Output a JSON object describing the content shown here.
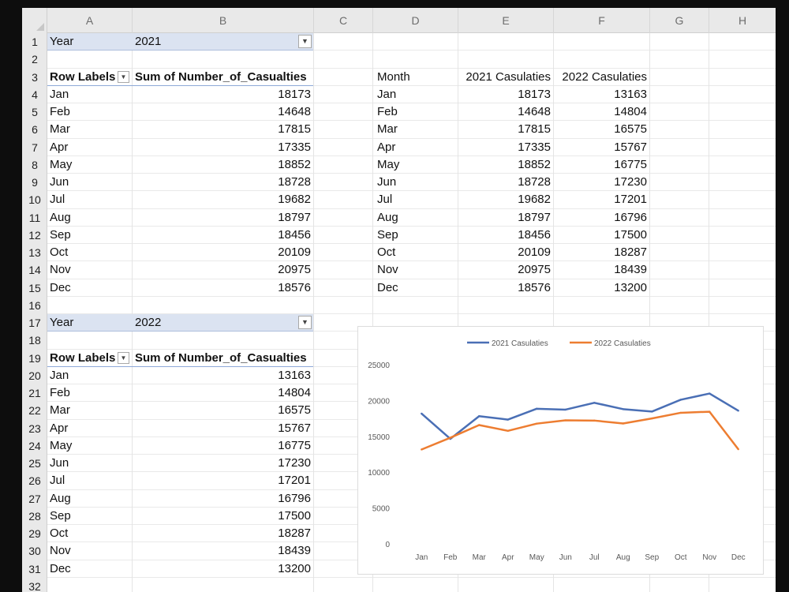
{
  "columns": [
    "A",
    "B",
    "C",
    "D",
    "E",
    "F",
    "G",
    "H"
  ],
  "rows": [
    "1",
    "2",
    "3",
    "4",
    "5",
    "6",
    "7",
    "8",
    "9",
    "10",
    "11",
    "12",
    "13",
    "14",
    "15",
    "16",
    "17",
    "18",
    "19",
    "20",
    "21",
    "22",
    "23",
    "24",
    "25",
    "26",
    "27",
    "28",
    "29",
    "30",
    "31",
    "32"
  ],
  "pivot2021": {
    "filter_label": "Year",
    "filter_value": "2021",
    "row_labels_header": "Row Labels",
    "value_header": "Sum of Number_of_Casualties",
    "months": [
      "Jan",
      "Feb",
      "Mar",
      "Apr",
      "May",
      "Jun",
      "Jul",
      "Aug",
      "Sep",
      "Oct",
      "Nov",
      "Dec"
    ],
    "values": [
      "18173",
      "14648",
      "17815",
      "17335",
      "18852",
      "18728",
      "19682",
      "18797",
      "18456",
      "20109",
      "20975",
      "18576"
    ]
  },
  "pivot2022": {
    "filter_label": "Year",
    "filter_value": "2022",
    "row_labels_header": "Row Labels",
    "value_header": "Sum of Number_of_Casualties",
    "months": [
      "Jan",
      "Feb",
      "Mar",
      "Apr",
      "May",
      "Jun",
      "Jul",
      "Aug",
      "Sep",
      "Oct",
      "Nov",
      "Dec"
    ],
    "values": [
      "13163",
      "14804",
      "16575",
      "15767",
      "16775",
      "17230",
      "17201",
      "16796",
      "17500",
      "18287",
      "18439",
      "13200"
    ]
  },
  "comparison": {
    "headers": [
      "Month",
      "2021 Casulaties",
      "2022 Casulaties"
    ],
    "rows": [
      [
        "Jan",
        "18173",
        "13163"
      ],
      [
        "Feb",
        "14648",
        "14804"
      ],
      [
        "Mar",
        "17815",
        "16575"
      ],
      [
        "Apr",
        "17335",
        "15767"
      ],
      [
        "May",
        "18852",
        "16775"
      ],
      [
        "Jun",
        "18728",
        "17230"
      ],
      [
        "Jul",
        "19682",
        "17201"
      ],
      [
        "Aug",
        "18797",
        "16796"
      ],
      [
        "Sep",
        "18456",
        "17500"
      ],
      [
        "Oct",
        "20109",
        "18287"
      ],
      [
        "Nov",
        "20975",
        "18439"
      ],
      [
        "Dec",
        "18576",
        "13200"
      ]
    ]
  },
  "chart_data": {
    "type": "line",
    "title": "",
    "xlabel": "",
    "ylabel": "",
    "x": [
      "Jan",
      "Feb",
      "Mar",
      "Apr",
      "May",
      "Jun",
      "Jul",
      "Aug",
      "Sep",
      "Oct",
      "Nov",
      "Dec"
    ],
    "yticks": [
      "0",
      "5000",
      "10000",
      "15000",
      "20000",
      "25000"
    ],
    "ylim": [
      0,
      25000
    ],
    "legend_position": "top",
    "grid": false,
    "series": [
      {
        "name": "2021 Casulaties",
        "color": "#4a6fb5",
        "values": [
          18173,
          14648,
          17815,
          17335,
          18852,
          18728,
          19682,
          18797,
          18456,
          20109,
          20975,
          18576
        ]
      },
      {
        "name": "2022 Casulaties",
        "color": "#ed7d31",
        "values": [
          13163,
          14804,
          16575,
          15767,
          16775,
          17230,
          17201,
          16796,
          17500,
          18287,
          18439,
          13200
        ]
      }
    ]
  },
  "icons": {
    "filter": "filter-icon",
    "dropdown": "dropdown-arrow-icon"
  }
}
